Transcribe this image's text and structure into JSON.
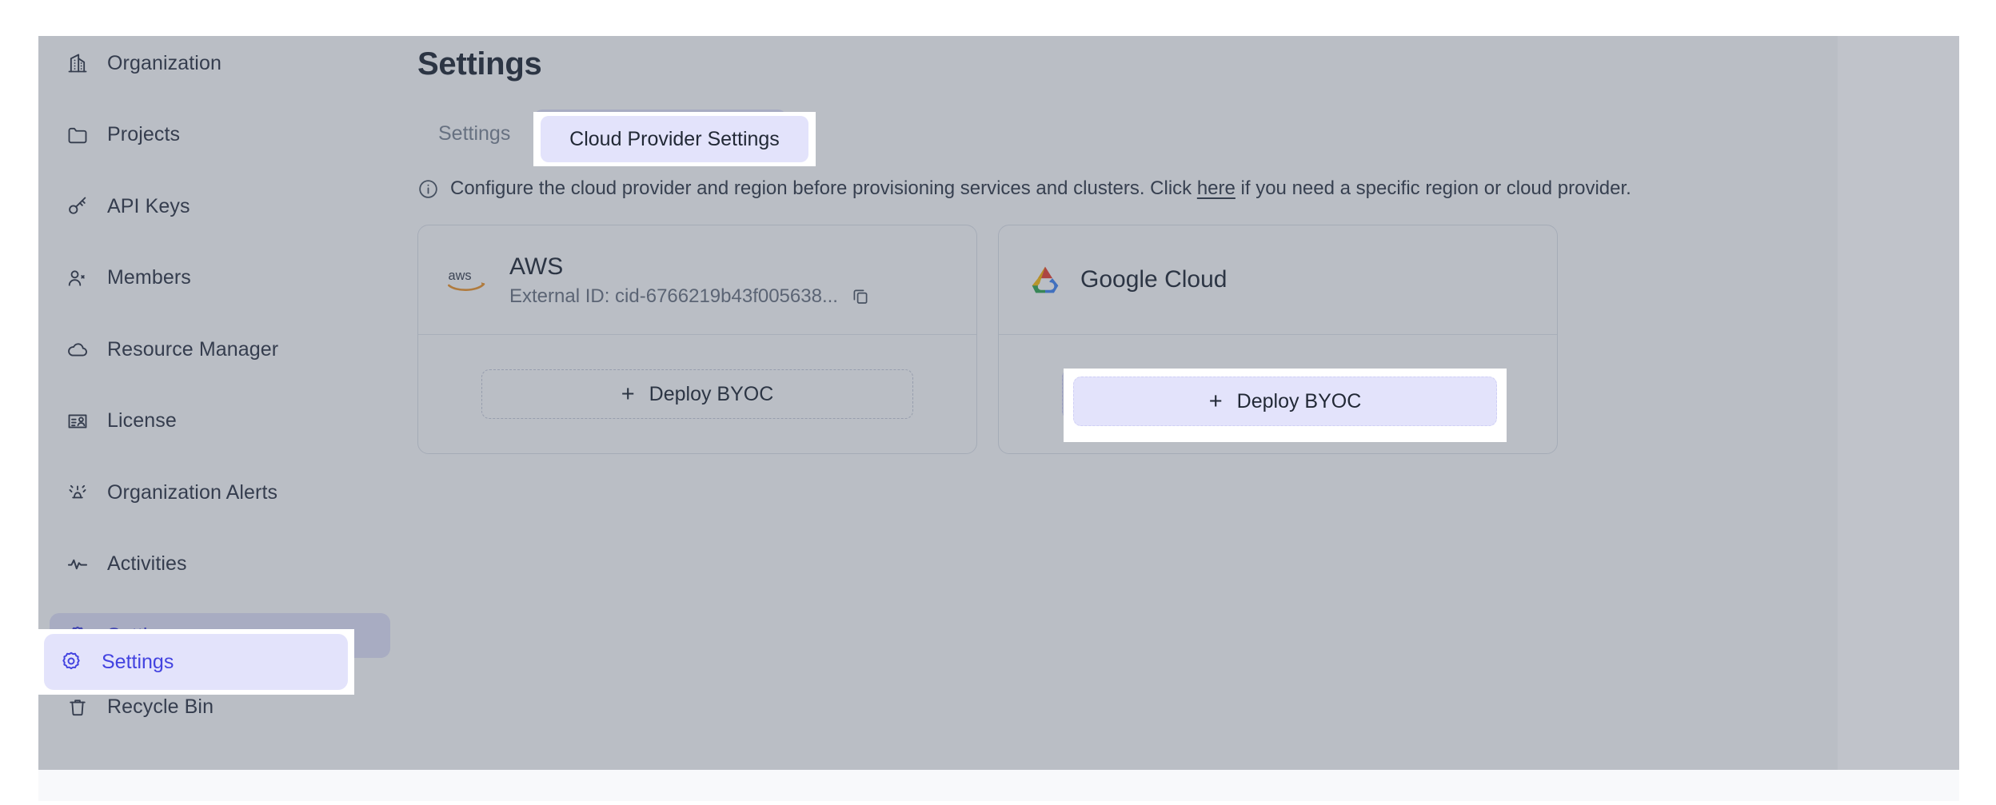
{
  "sidebar": {
    "items": [
      {
        "label": "Organization",
        "icon": "building-icon",
        "active": false
      },
      {
        "label": "Projects",
        "icon": "folder-icon",
        "active": false
      },
      {
        "label": "API Keys",
        "icon": "key-icon",
        "active": false
      },
      {
        "label": "Members",
        "icon": "users-icon",
        "active": false
      },
      {
        "label": "Resource Manager",
        "icon": "cloud-icon",
        "active": false
      },
      {
        "label": "License",
        "icon": "license-card-icon",
        "active": false
      },
      {
        "label": "Organization Alerts",
        "icon": "alert-siren-icon",
        "active": false
      },
      {
        "label": "Activities",
        "icon": "activity-pulse-icon",
        "active": false
      },
      {
        "label": "Settings",
        "icon": "gear-icon",
        "active": true
      },
      {
        "label": "Recycle Bin",
        "icon": "trash-icon",
        "active": false
      }
    ]
  },
  "main": {
    "page_title": "Settings",
    "tabs": [
      {
        "label": "Settings",
        "selected": false
      },
      {
        "label": "Cloud Provider Settings",
        "selected": true
      }
    ],
    "info": {
      "icon": "info-circle-icon",
      "text_before": "Configure the cloud provider and region before provisioning services and clusters. Click ",
      "link_text": "here",
      "text_after": " if you need a specific region or cloud provider."
    },
    "providers": [
      {
        "name": "AWS",
        "logo": "aws-logo-icon",
        "external_id_label": "External ID: cid-6766219b43f005638...",
        "copy_icon": "copy-icon",
        "deploy_label": "Deploy BYOC",
        "deploy_plus": "+",
        "highlighted": false
      },
      {
        "name": "Google Cloud",
        "logo": "google-cloud-logo-icon",
        "external_id_label": null,
        "copy_icon": null,
        "deploy_label": "Deploy BYOC",
        "deploy_plus": "+",
        "highlighted": true
      }
    ]
  },
  "spotlights": {
    "sidebar_settings_label": "Settings",
    "tab_label": "Cloud Provider Settings",
    "deploy_label": "Deploy BYOC",
    "deploy_plus": "+"
  },
  "colors": {
    "accent": "#4343e0",
    "accent_bg": "#e3e3fb",
    "text": "#222936",
    "muted": "#7e8795",
    "card_border": "#dfe3ea",
    "aws_orange": "#f0962c",
    "overlay": "rgba(64,74,94,0.36)"
  }
}
